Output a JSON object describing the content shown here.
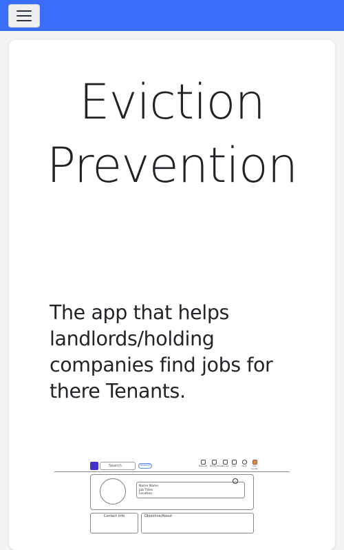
{
  "navbar": {
    "color": "#3b6ef8",
    "menu_icon": "hamburger-menu-icon"
  },
  "hero": {
    "title": "Eviction Prevention",
    "tagline": "The app that helps landlords/holding companies find jobs for there Tenants."
  },
  "mockup": {
    "search_placeholder": "Search",
    "search_button": "Search",
    "nav_items": [
      "Network",
      "Notifications",
      "Groups",
      "Jobs",
      "Work",
      "Our Guide"
    ],
    "profile_lines": [
      "Name Name",
      "Job Titles",
      "Location"
    ],
    "contact_heading": "Contact Info",
    "about_heading": "Objective/About"
  }
}
